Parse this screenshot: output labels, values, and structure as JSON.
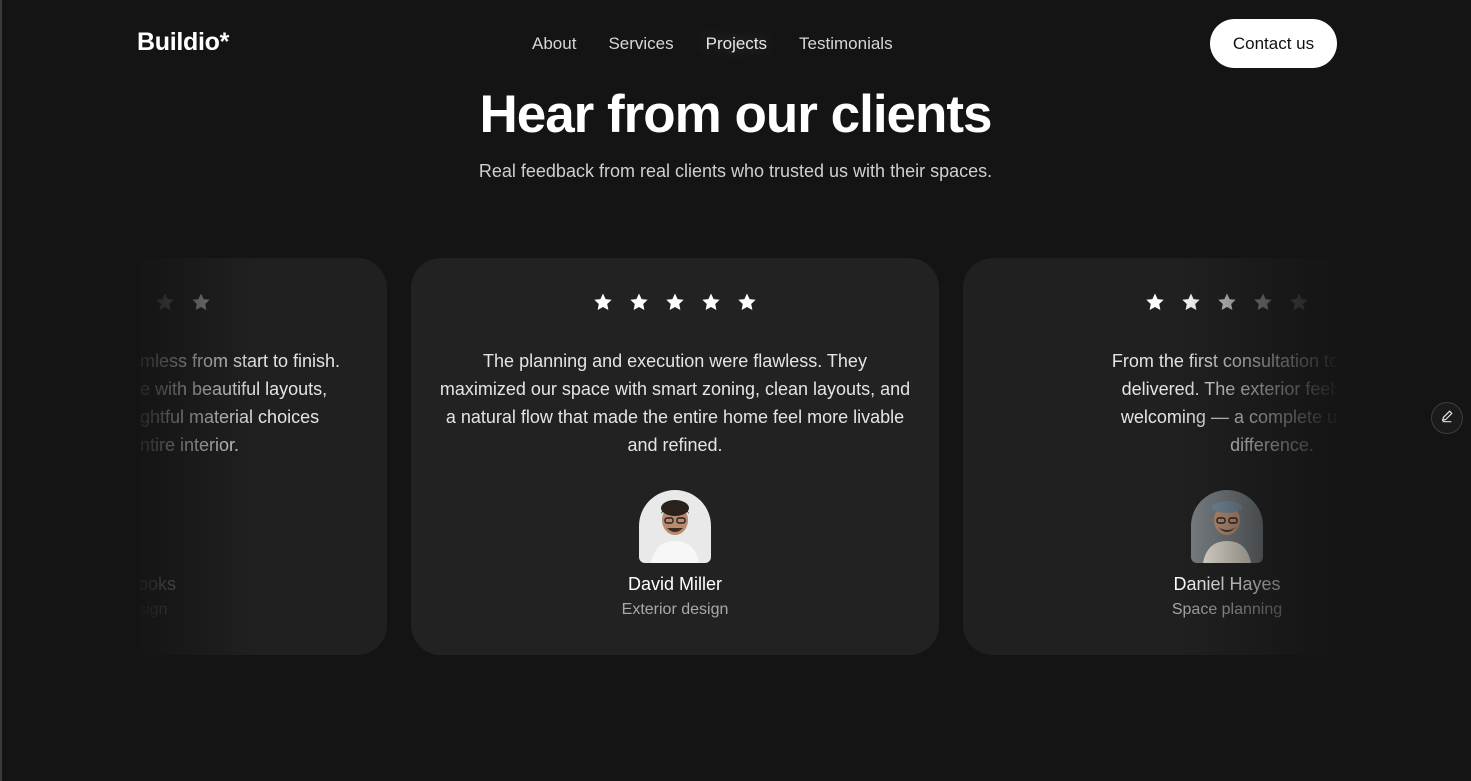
{
  "header": {
    "logo": "Buildio*",
    "nav": [
      "About",
      "Services",
      "Projects",
      "Testimonials"
    ],
    "contact_label": "Contact us"
  },
  "hero": {
    "title": "Hear from our clients",
    "subtitle": "Real feedback from real clients who trusted us with their spaces."
  },
  "testimonials": [
    {
      "quote_lines": [
        "mless from start to finish.",
        "e with beautiful layouts,",
        "ghtful material choices",
        "ntire interior."
      ],
      "name": "ooks",
      "role": "sign",
      "rating": 5
    },
    {
      "quote_lines": [
        "The planning and execution were flawless. They",
        "maximized our space with smart zoning, clean layouts, and",
        "a natural flow that made the entire home feel more livable",
        "and refined."
      ],
      "name": "David Miller",
      "role": "Exterior design",
      "rating": 5
    },
    {
      "quote_lines": [
        "From the first consultation to the final de",
        "delivered. The exterior feels fresh, bal",
        "welcoming — a complete upgrade tha",
        "difference."
      ],
      "name": "Daniel Hayes",
      "role": "Space planning",
      "rating": 5
    }
  ],
  "colors": {
    "background": "#141414",
    "card": "#222222",
    "accent": "#ffffff"
  },
  "icons": {
    "star": "star-icon",
    "edit": "pencil-icon"
  }
}
